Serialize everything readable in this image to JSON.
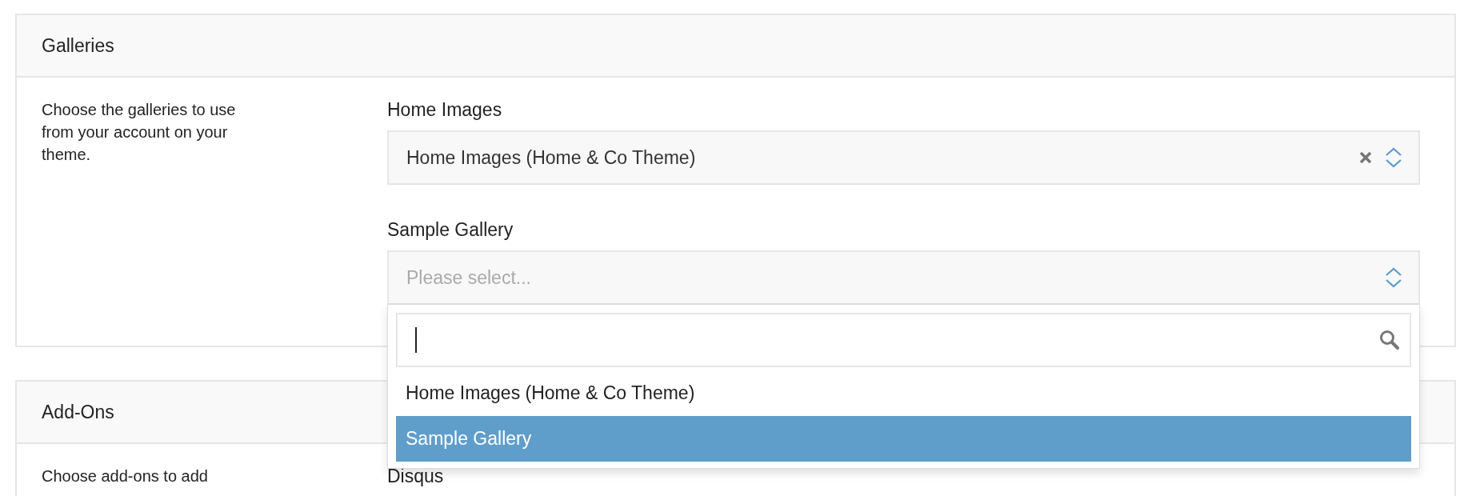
{
  "sections": [
    {
      "title": "Galleries",
      "description": "Choose the galleries to use from your account on your theme.",
      "fields": [
        {
          "label": "Home Images",
          "value": "Home Images (Home & Co Theme)",
          "clearable": true,
          "expanded": false
        },
        {
          "label": "Sample Gallery",
          "placeholder": "Please select...",
          "expanded": true,
          "options": [
            {
              "label": "Home Images (Home & Co Theme)",
              "selected": false
            },
            {
              "label": "Sample Gallery",
              "selected": true
            }
          ]
        }
      ]
    },
    {
      "title": "Add-Ons",
      "description": "Choose add-ons to add",
      "fields": [
        {
          "label": "Disqus"
        }
      ]
    }
  ]
}
